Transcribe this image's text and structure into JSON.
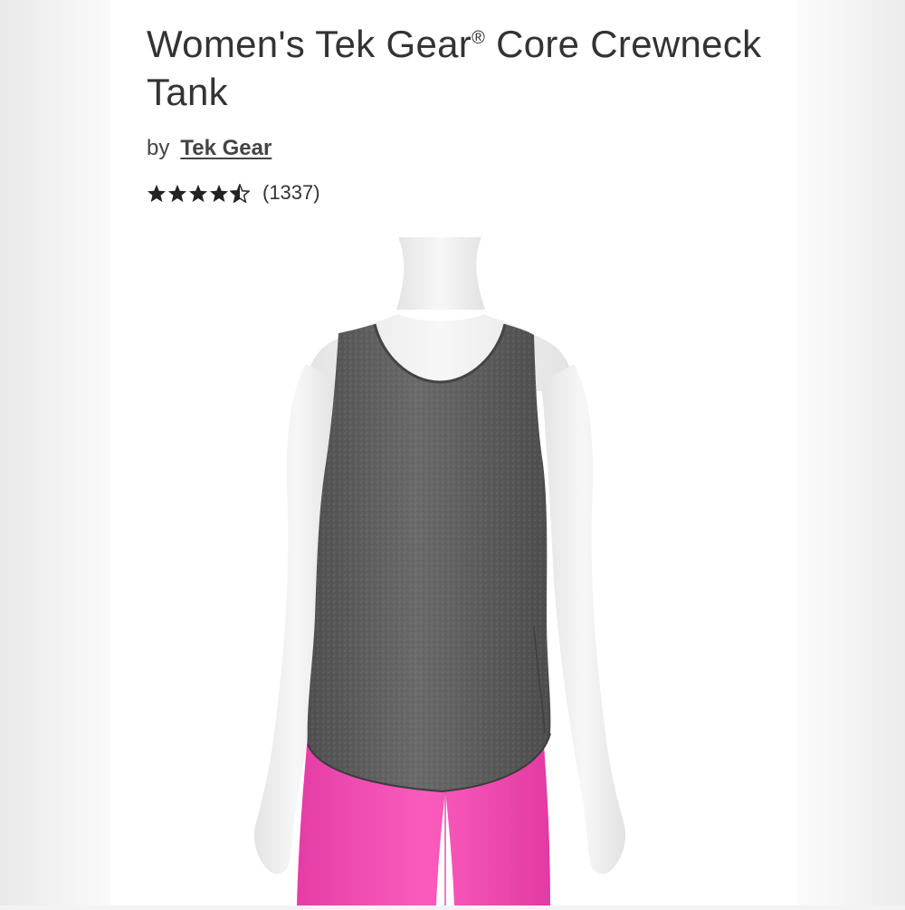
{
  "product": {
    "title_main": "Women's Tek Gear",
    "title_mark": "®",
    "title_rest": " Core Crewneck Tank",
    "by_label": "by",
    "brand": "Tek Gear",
    "rating": {
      "value": 4.5,
      "max": 5,
      "count_text": "(1337)"
    }
  },
  "colors": {
    "tank": "#5e5e5e",
    "leggings": "#f54fb5",
    "mannequin": "#f2f2f2",
    "text": "#333333"
  },
  "icons": [
    "star-icon",
    "half-star-icon"
  ]
}
